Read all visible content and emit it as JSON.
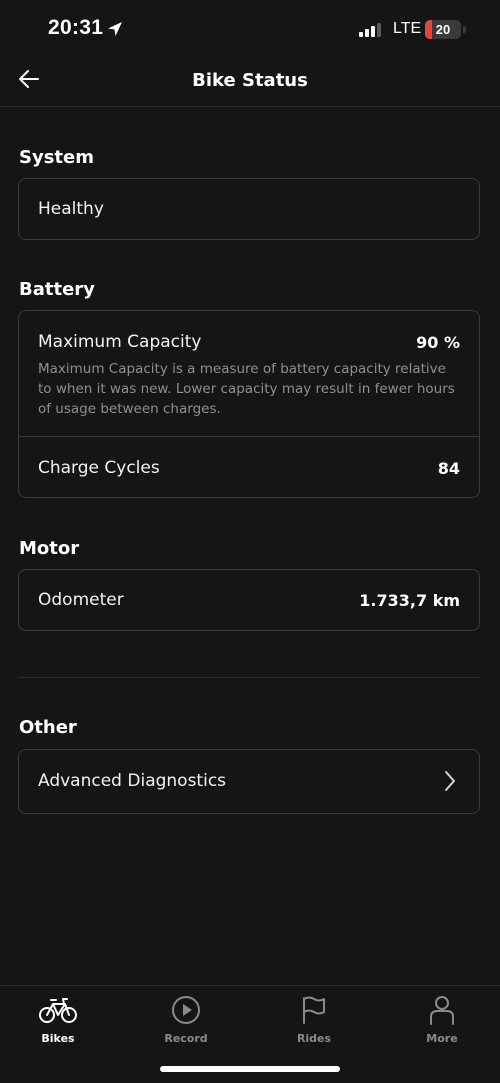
{
  "status_bar": {
    "time": "20:31",
    "network": "LTE",
    "battery_level": "20",
    "battery_fraction": 0.2,
    "battery_color": "#e5453a",
    "location_icon": "location-arrow-icon",
    "signal_icon": "cellular-signal-icon"
  },
  "header": {
    "title": "Bike Status",
    "back_icon": "back-arrow-icon"
  },
  "sections": {
    "system": {
      "title": "System",
      "status": "Healthy"
    },
    "battery": {
      "title": "Battery",
      "max_capacity_label": "Maximum Capacity",
      "max_capacity_value": "90 %",
      "max_capacity_desc": "Maximum Capacity is a measure of battery capacity relative to when it was new. Lower capacity may result in fewer hours of usage between charges.",
      "charge_cycles_label": "Charge Cycles",
      "charge_cycles_value": "84"
    },
    "motor": {
      "title": "Motor",
      "odometer_label": "Odometer",
      "odometer_value": "1.733,7 km"
    },
    "other": {
      "title": "Other",
      "advanced_label": "Advanced Diagnostics",
      "chevron_icon": "chevron-right-icon"
    }
  },
  "tab_bar": {
    "tabs": [
      {
        "label": "Bikes",
        "icon": "bike-icon",
        "active": true
      },
      {
        "label": "Record",
        "icon": "play-circle-icon",
        "active": false
      },
      {
        "label": "Rides",
        "icon": "flag-icon",
        "active": false
      },
      {
        "label": "More",
        "icon": "person-icon",
        "active": false
      }
    ]
  },
  "colors": {
    "background": "#151515",
    "border": "#3a3a3a",
    "text_secondary": "#8f8f8f",
    "tab_inactive": "#8a8a8a"
  }
}
